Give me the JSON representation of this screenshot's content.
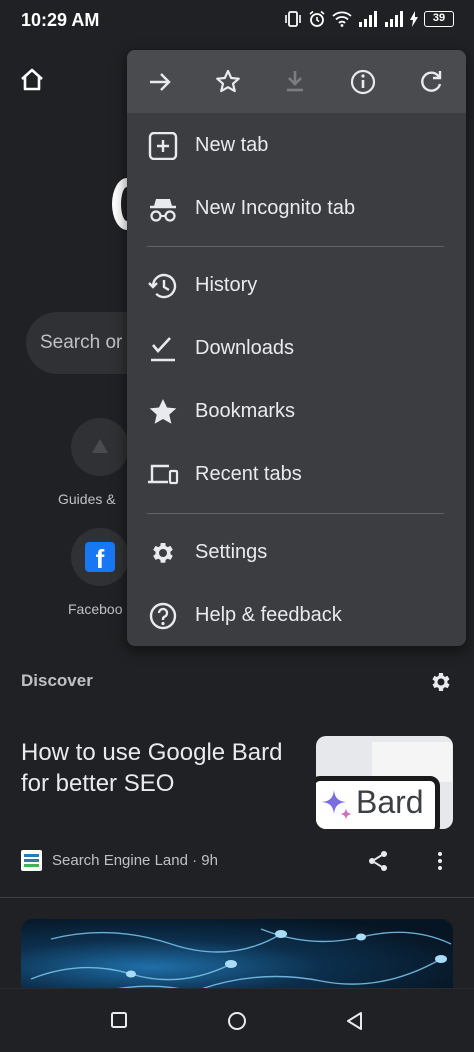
{
  "status_bar": {
    "time": "10:29 AM",
    "battery": "39"
  },
  "page": {
    "search_placeholder": "Search or",
    "shortcuts": [
      {
        "label": "Guides &"
      },
      {
        "label": "Faceboo"
      }
    ]
  },
  "discover": {
    "title": "Discover",
    "article": {
      "title": "How to use Google Bard for better SEO",
      "thumbnail_text": "Bard",
      "source": "Search Engine Land · 9h"
    }
  },
  "menu": {
    "toolbar": [
      {
        "icon": "forward-arrow-icon"
      },
      {
        "icon": "star-icon"
      },
      {
        "icon": "download-icon",
        "disabled": true
      },
      {
        "icon": "info-icon"
      },
      {
        "icon": "refresh-icon"
      }
    ],
    "items": [
      {
        "label": "New tab",
        "icon": "add-box-icon"
      },
      {
        "label": "New Incognito tab",
        "icon": "incognito-icon"
      },
      {
        "label": "History",
        "icon": "history-icon"
      },
      {
        "label": "Downloads",
        "icon": "downloads-check-icon"
      },
      {
        "label": "Bookmarks",
        "icon": "bookmark-star-icon"
      },
      {
        "label": "Recent tabs",
        "icon": "devices-icon"
      },
      {
        "label": "Settings",
        "icon": "settings-gear-icon"
      },
      {
        "label": "Help & feedback",
        "icon": "help-icon"
      }
    ]
  },
  "colors": {
    "background": "#202124",
    "menu": "#3c3d40",
    "menu_toolbar": "#4a4b4e",
    "text": "#e8eaed",
    "facebook": "#1877f2"
  }
}
